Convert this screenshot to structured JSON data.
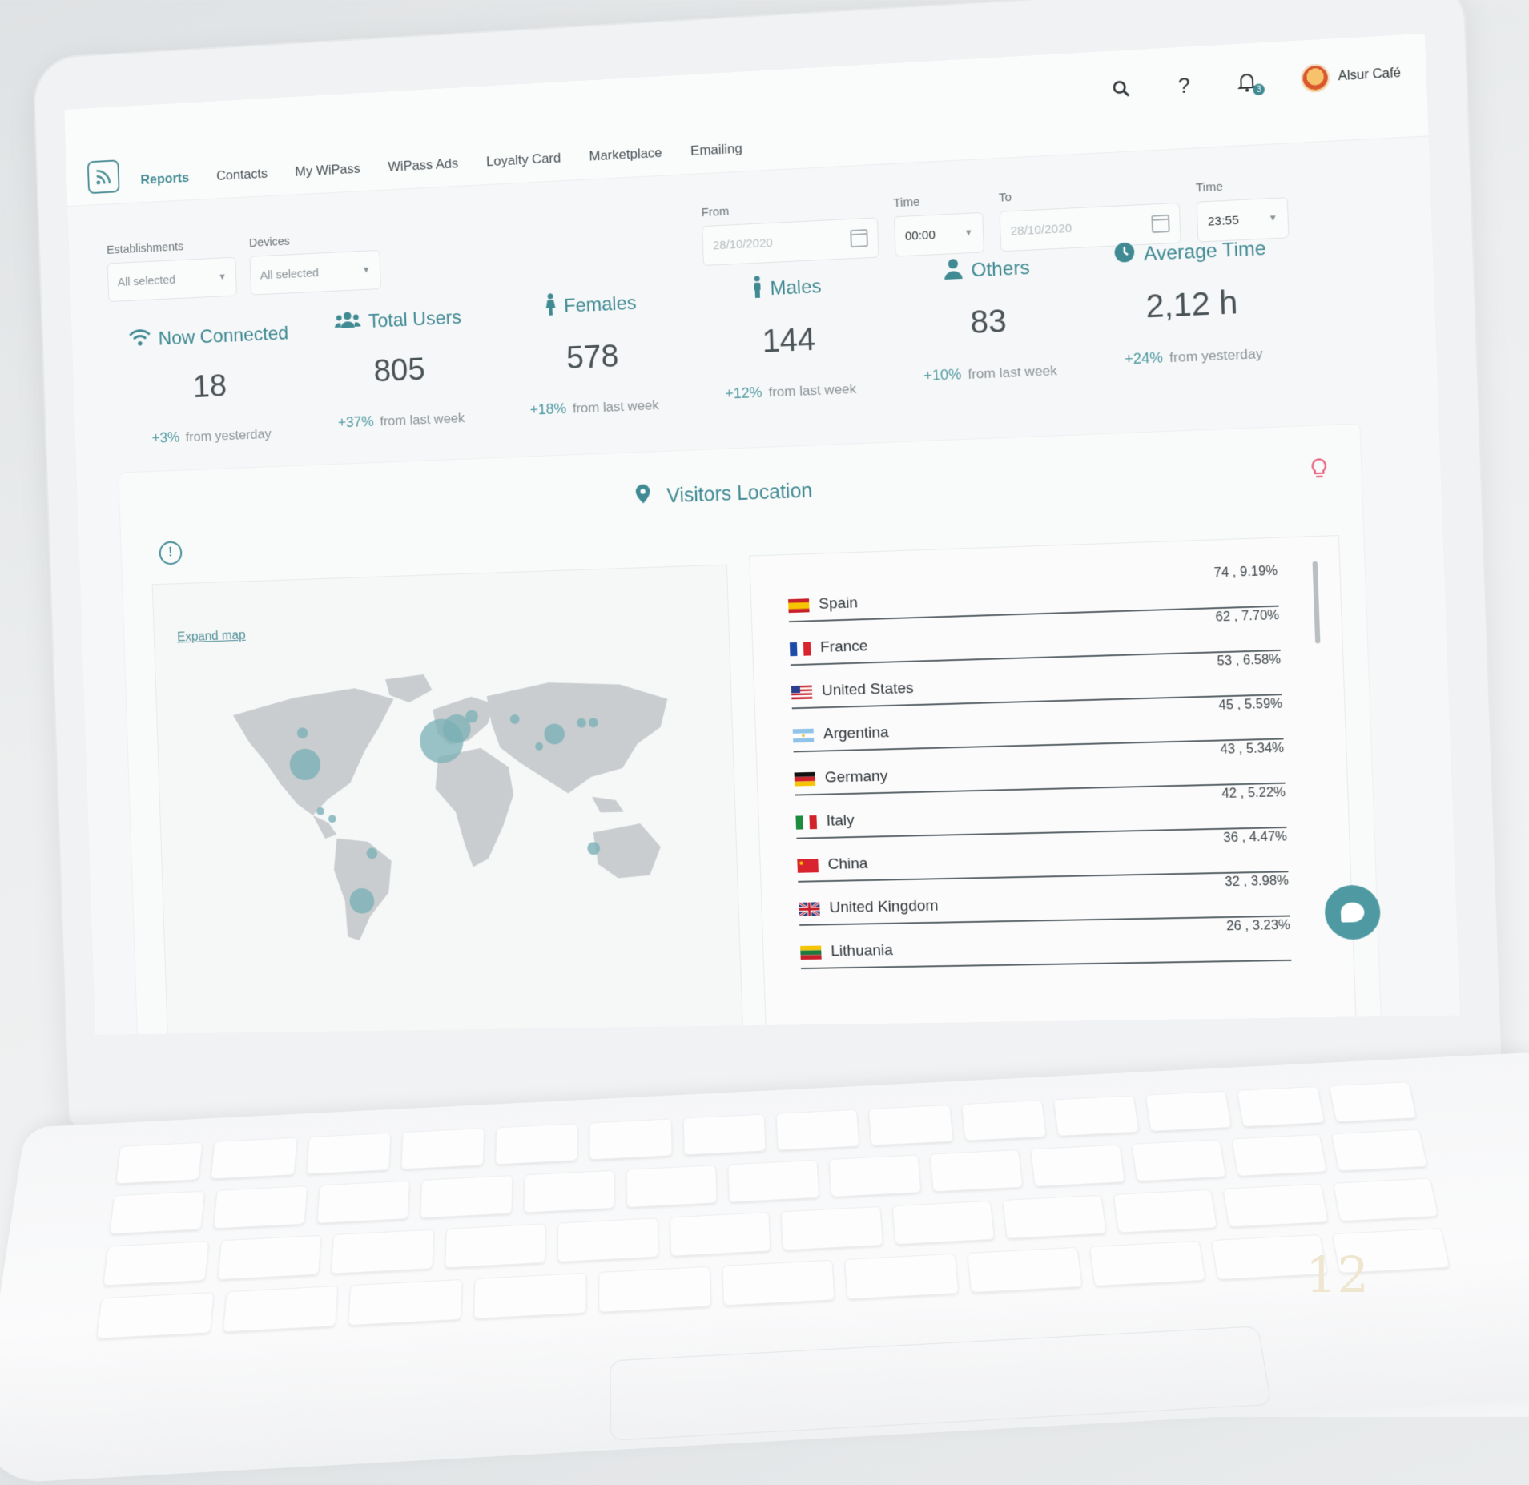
{
  "nav": {
    "items": [
      "Reports",
      "Contacts",
      "My WiPass",
      "WiPass Ads",
      "Loyalty Card",
      "Marketplace",
      "Emailing"
    ],
    "active": "Reports"
  },
  "header": {
    "notification_count": "3",
    "user_name": "Alsur Café"
  },
  "filters": {
    "establishments_label": "Establishments",
    "establishments_value": "All selected",
    "devices_label": "Devices",
    "devices_value": "All selected",
    "from_label": "From",
    "from_value": "28/10/2020",
    "time_from_label": "Time",
    "time_from_value": "00:00",
    "to_label": "To",
    "to_value": "28/10/2020",
    "time_to_label": "Time",
    "time_to_value": "23:55"
  },
  "stats": [
    {
      "label": "Now Connected",
      "value": "18",
      "change": "+3%",
      "period": "from yesterday",
      "icon": "wifi-icon"
    },
    {
      "label": "Total Users",
      "value": "805",
      "change": "+37%",
      "period": "from last week",
      "icon": "users-icon"
    },
    {
      "label": "Females",
      "value": "578",
      "change": "+18%",
      "period": "from last week",
      "icon": "female-icon"
    },
    {
      "label": "Males",
      "value": "144",
      "change": "+12%",
      "period": "from last week",
      "icon": "male-icon"
    },
    {
      "label": "Others",
      "value": "83",
      "change": "+10%",
      "period": "from last week",
      "icon": "person-icon"
    },
    {
      "label": "Average Time",
      "value": "2,12 h",
      "change": "+24%",
      "period": "from yesterday",
      "icon": "clock-icon"
    }
  ],
  "location": {
    "title": "Visitors Location",
    "expand_link": "Expand map",
    "countries": [
      {
        "name": "Spain",
        "value": "74 , 9.19%"
      },
      {
        "name": "France",
        "value": "62 , 7.70%"
      },
      {
        "name": "United States",
        "value": "53 , 6.58%"
      },
      {
        "name": "Argentina",
        "value": "45 , 5.59%"
      },
      {
        "name": "Germany",
        "value": "43 , 5.34%"
      },
      {
        "name": "Italy",
        "value": "42 , 5.22%"
      },
      {
        "name": "China",
        "value": "36 , 4.47%"
      },
      {
        "name": "United Kingdom",
        "value": "32 , 3.98%"
      },
      {
        "name": "Lithuania",
        "value": "26 , 3.23%"
      }
    ]
  },
  "colors": {
    "accent": "#3f8a93",
    "bulb": "#e8627d"
  },
  "page_number": "12"
}
